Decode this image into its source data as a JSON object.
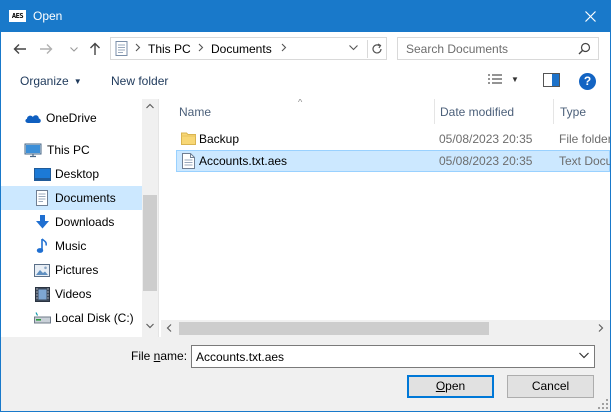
{
  "window": {
    "title": "Open",
    "app_icon_text": "AES"
  },
  "colors": {
    "titlebar": "#1979ca",
    "selection_bg": "#cce8ff",
    "selection_border": "#99d1ff",
    "help_blue": "#1364c3",
    "folder_yellow": "#f8d775"
  },
  "address": {
    "crumbs": [
      "This PC",
      "Documents"
    ]
  },
  "search": {
    "placeholder": "Search Documents"
  },
  "toolbar": {
    "organize_label": "Organize",
    "new_folder_label": "New folder",
    "help_label": "?"
  },
  "nav": {
    "items": [
      {
        "label": "OneDrive",
        "icon": "onedrive-icon"
      },
      {
        "label": "This PC",
        "icon": "computer-icon"
      },
      {
        "label": "Desktop",
        "icon": "desktop-icon"
      },
      {
        "label": "Documents",
        "icon": "documents-icon",
        "selected": true
      },
      {
        "label": "Downloads",
        "icon": "downloads-icon"
      },
      {
        "label": "Music",
        "icon": "music-icon"
      },
      {
        "label": "Pictures",
        "icon": "pictures-icon"
      },
      {
        "label": "Videos",
        "icon": "videos-icon"
      },
      {
        "label": "Local Disk (C:)",
        "icon": "drive-icon"
      }
    ]
  },
  "files": {
    "columns": {
      "name": "Name",
      "date": "Date modified",
      "type": "Type"
    },
    "rows": [
      {
        "name": "Backup",
        "date": "05/08/2023 20:35",
        "type": "File folder",
        "icon": "folder-icon"
      },
      {
        "name": "Accounts.txt.aes",
        "date": "05/08/2023 20:35",
        "type": "Text Document",
        "icon": "file-icon",
        "selected": true
      }
    ]
  },
  "footer": {
    "file_name_label_pre": "File ",
    "file_name_label_u": "n",
    "file_name_label_post": "ame:",
    "file_name_value": "Accounts.txt.aes",
    "open_u": "O",
    "open_rest": "pen",
    "cancel_label": "Cancel"
  }
}
